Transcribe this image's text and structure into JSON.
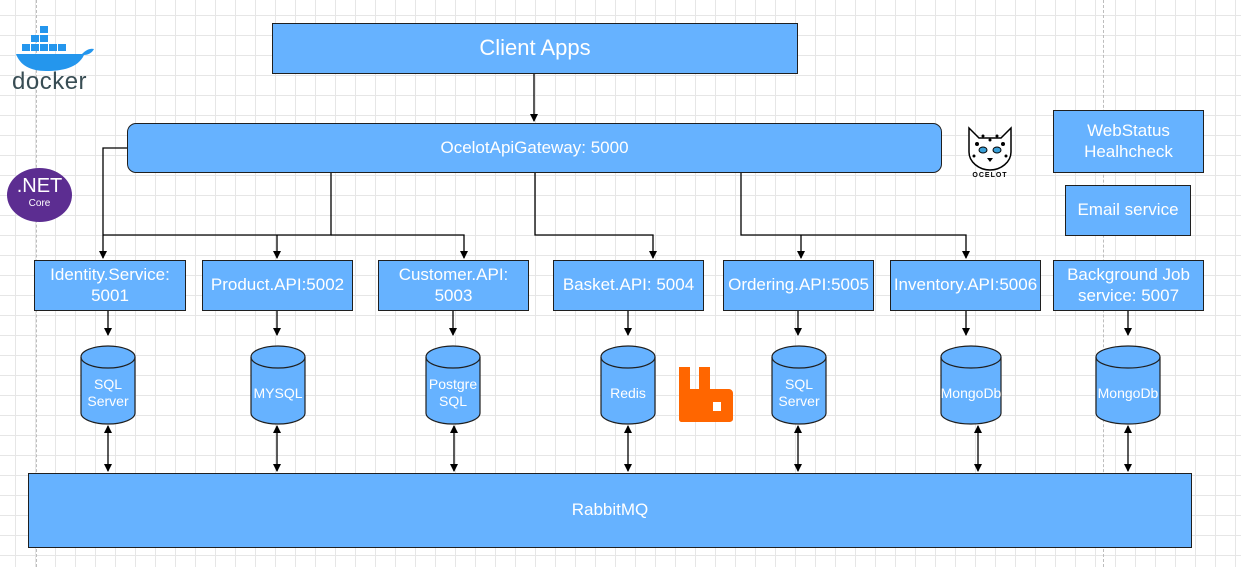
{
  "diagram": {
    "client": {
      "label": "Client Apps"
    },
    "gateway": {
      "label": "OcelotApiGateway: 5000"
    },
    "bus": {
      "label": "RabbitMQ"
    },
    "services": [
      {
        "id": "identity",
        "label": "Identity.Service:\n5001",
        "db": "SQL\nServer"
      },
      {
        "id": "product",
        "label": "Product.API:5002",
        "db": "MYSQL"
      },
      {
        "id": "customer",
        "label": "Customer.API:\n5003",
        "db": "Postgre\nSQL"
      },
      {
        "id": "basket",
        "label": "Basket.API: 5004",
        "db": "Redis"
      },
      {
        "id": "ordering",
        "label": "Ordering.API:5005",
        "db": "SQL\nServer"
      },
      {
        "id": "inventory",
        "label": "Inventory.API:5006",
        "db": "MongoDb"
      },
      {
        "id": "background",
        "label": "Background Job\nservice: 5007",
        "db": "MongoDb"
      }
    ],
    "side_services": [
      {
        "id": "webstatus",
        "label": "WebStatus\nHealhcheck"
      },
      {
        "id": "email",
        "label": "Email service"
      }
    ],
    "logos": {
      "docker": {
        "icon": "docker-whale-icon",
        "text": "docker"
      },
      "dotnet": {
        "icon": "dotnet-core-icon",
        "text": ".NET",
        "subtext": "Core"
      },
      "ocelot": {
        "icon": "ocelot-cat-icon",
        "text": "OCELOT"
      },
      "rabbitmq": {
        "icon": "rabbitmq-icon"
      }
    },
    "colors": {
      "box_fill": "#66b2ff",
      "border": "#1f1f1f",
      "text": "#ffffff",
      "dotnet": "#5c2d91",
      "rabbitmq": "#ff6600",
      "docker": "#2496ed"
    }
  }
}
